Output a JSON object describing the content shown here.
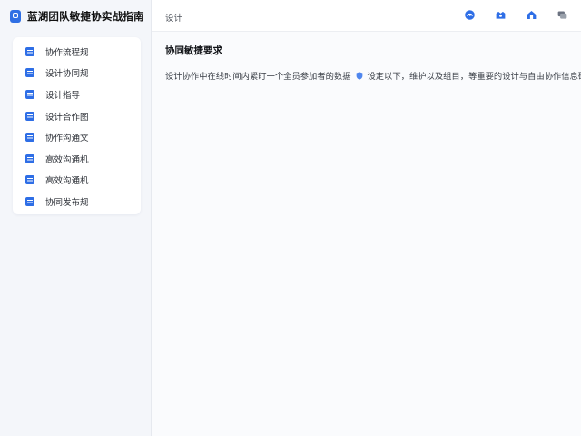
{
  "app": {
    "title": "蓝湖团队敏捷协实战指南"
  },
  "sidebar": {
    "items": [
      {
        "label": "协作流程规"
      },
      {
        "label": "设计协同规"
      },
      {
        "label": "设计指导"
      },
      {
        "label": "设计合作图"
      },
      {
        "label": "协作沟通文"
      },
      {
        "label": "高效沟通机"
      },
      {
        "label": "高效沟通机"
      },
      {
        "label": "协同发布规"
      }
    ]
  },
  "header": {
    "breadcrumb": "设计",
    "actions": [
      {
        "icon": "dashboard-icon"
      },
      {
        "icon": "team-icon"
      },
      {
        "icon": "home-icon"
      },
      {
        "icon": "message-icon"
      }
    ]
  },
  "content": {
    "heading": "协同敏捷要求",
    "paragraph_before": "设计协作中在线时间内紧盯一个全员参加者的数据 ",
    "paragraph_after": " 设定以下，维护以及组目，等重要的设计与自由协作信息研究。"
  },
  "colors": {
    "accent": "#2e6ee6"
  }
}
